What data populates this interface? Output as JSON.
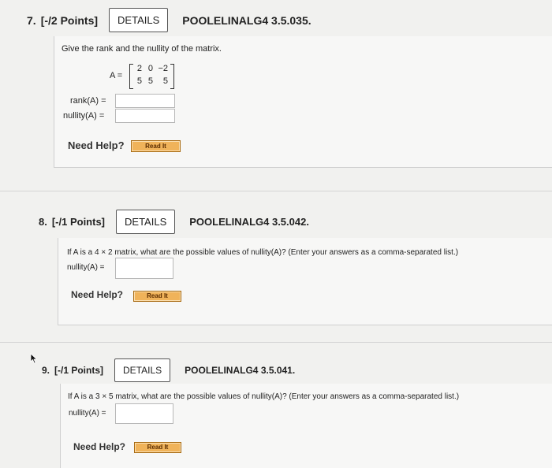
{
  "questions": [
    {
      "number": "7.",
      "points": "[-/2 Points]",
      "details_label": "DETAILS",
      "code": "POOLELINALG4 3.5.035.",
      "prompt": "Give the rank and the nullity of the matrix.",
      "matrix_label": "A =",
      "matrix": [
        [
          "2",
          "0",
          "−2"
        ],
        [
          "5",
          "5",
          "5"
        ]
      ],
      "fields": [
        {
          "label": "rank(A) =",
          "value": ""
        },
        {
          "label": "nullity(A) =",
          "value": ""
        }
      ],
      "need_help": "Need Help?",
      "read_it": "Read It"
    },
    {
      "number": "8.",
      "points": "[-/1 Points]",
      "details_label": "DETAILS",
      "code": "POOLELINALG4 3.5.042.",
      "prompt": "If A is a 4 × 2 matrix, what are the possible values of nullity(A)? (Enter your answers as a comma-separated list.)",
      "fields": [
        {
          "label": "nullity(A) =",
          "value": ""
        }
      ],
      "need_help": "Need Help?",
      "read_it": "Read It"
    },
    {
      "number": "9.",
      "points": "[-/1 Points]",
      "details_label": "DETAILS",
      "code": "POOLELINALG4 3.5.041.",
      "prompt": "If A is a 3 × 5 matrix, what are the possible values of nullity(A)? (Enter your answers as a comma-separated list.)",
      "fields": [
        {
          "label": "nullity(A) =",
          "value": ""
        }
      ],
      "need_help": "Need Help?",
      "read_it": "Read It"
    }
  ]
}
